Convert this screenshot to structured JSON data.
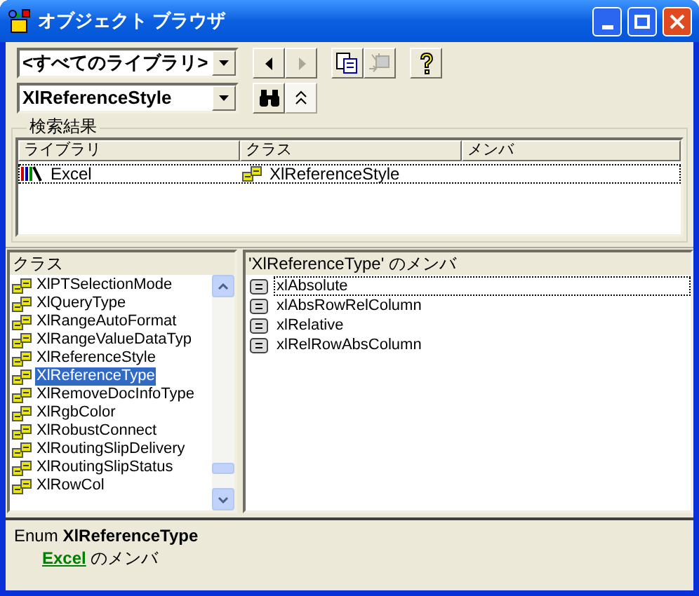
{
  "window": {
    "title": "オブジェクト ブラウザ"
  },
  "library_combo": {
    "value": "<すべてのライブラリ>"
  },
  "toolbar": [
    {
      "kind": "back",
      "disabled": false
    },
    {
      "kind": "forward",
      "disabled": true
    },
    {
      "kind": "copy",
      "disabled": false
    },
    {
      "kind": "definition",
      "disabled": true
    },
    {
      "kind": "help",
      "disabled": false
    }
  ],
  "search_combo": {
    "value": "XlReferenceStyle"
  },
  "search_buttons": [
    {
      "kind": "search"
    },
    {
      "kind": "collapse"
    }
  ],
  "search_results": {
    "title": "検索結果",
    "columns": [
      "ライブラリ",
      "クラス",
      "メンバ"
    ],
    "rows": [
      {
        "library": "Excel",
        "class": "XlReferenceStyle",
        "selected": true
      }
    ]
  },
  "classes": {
    "title": "クラス",
    "items": [
      {
        "name": "XlPTSelectionMode",
        "selected": false
      },
      {
        "name": "XlQueryType",
        "selected": false
      },
      {
        "name": "XlRangeAutoFormat",
        "selected": false
      },
      {
        "name": "XlRangeValueDataTyp",
        "selected": false
      },
      {
        "name": "XlReferenceStyle",
        "selected": false
      },
      {
        "name": "XlReferenceType",
        "selected": true
      },
      {
        "name": "XlRemoveDocInfoType",
        "selected": false
      },
      {
        "name": "XlRgbColor",
        "selected": false
      },
      {
        "name": "XlRobustConnect",
        "selected": false
      },
      {
        "name": "XlRoutingSlipDelivery",
        "selected": false
      },
      {
        "name": "XlRoutingSlipStatus",
        "selected": false
      },
      {
        "name": "XlRowCol",
        "selected": false
      }
    ]
  },
  "members": {
    "title": "'XlReferenceType' のメンバ",
    "items": [
      {
        "name": "xlAbsolute",
        "selected": true
      },
      {
        "name": "xlAbsRowRelColumn",
        "selected": false
      },
      {
        "name": "xlRelative",
        "selected": false
      },
      {
        "name": "xlRelRowAbsColumn",
        "selected": false
      }
    ]
  },
  "details": {
    "declaration": "Enum **XlReferenceType**",
    "library_link": "Excel",
    "suffix": "のメンバ"
  }
}
